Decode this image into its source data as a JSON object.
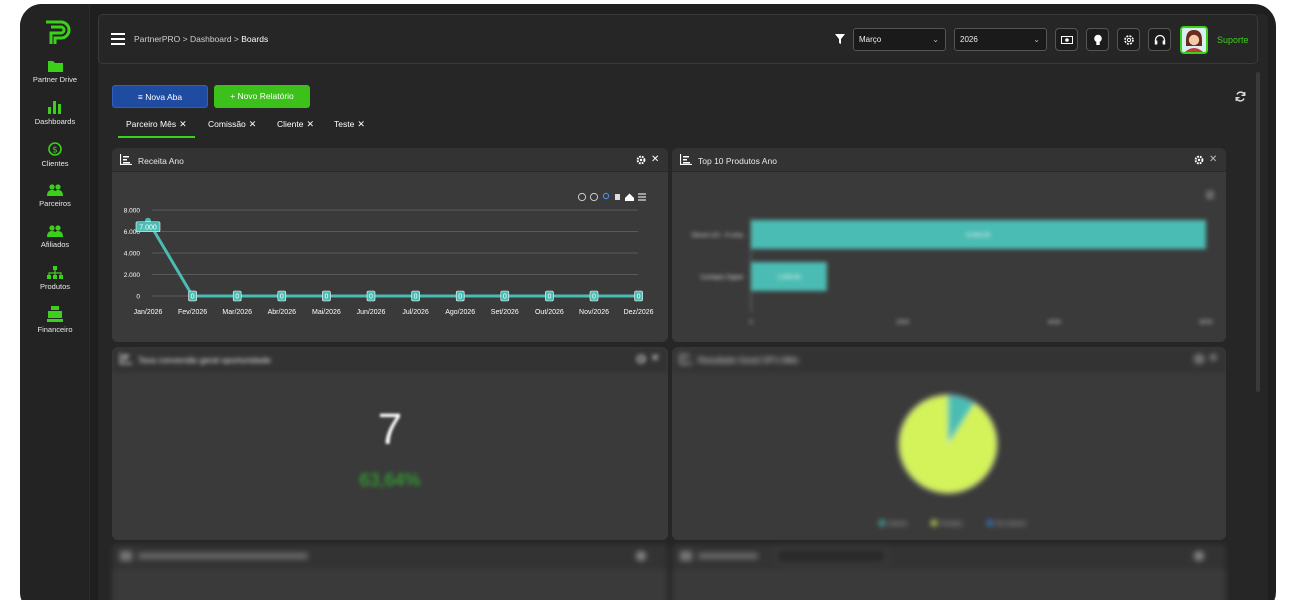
{
  "sidebar": {
    "items": [
      {
        "label": "Partner Drive",
        "icon": "folder-icon"
      },
      {
        "label": "Dashboards",
        "icon": "bar-chart-icon"
      },
      {
        "label": "Clientes",
        "icon": "dollar-circle-icon"
      },
      {
        "label": "Parceiros",
        "icon": "users-icon"
      },
      {
        "label": "Afiliados",
        "icon": "users-icon"
      },
      {
        "label": "Produtos",
        "icon": "hierarchy-icon"
      },
      {
        "label": "Financeiro",
        "icon": "cash-register-icon"
      }
    ]
  },
  "header": {
    "breadcrumb_prefix": "PartnerPRO > Dashboard > ",
    "breadcrumb_current": "Boards",
    "month_select": "Março",
    "year_select": "2026",
    "support_label": "Suporte"
  },
  "toolbar": {
    "new_tab_label": "Nova Aba",
    "new_report_label": "Novo Relatório"
  },
  "tabs": [
    {
      "label": "Parceiro Mês"
    },
    {
      "label": "Comissão"
    },
    {
      "label": "Cliente"
    },
    {
      "label": "Teste"
    }
  ],
  "panels": {
    "revenue": {
      "title": "Receita Ano"
    },
    "top_products": {
      "title": "Top 10 Produtos Ano"
    },
    "conversion": {
      "title": "Taxa conversão geral oportunidade",
      "value": "7",
      "percent": "63,64%"
    },
    "general_result": {
      "title": "Resultado Geral OP's Mês"
    }
  },
  "colors": {
    "accent_green": "#3bd11a",
    "teal": "#4bbcb3",
    "blue": "#1f4ba0",
    "lime": "#d4f25a"
  },
  "chart_data": [
    {
      "type": "line",
      "title": "Receita Ano",
      "categories": [
        "Jan/2026",
        "Fev/2026",
        "Mar/2026",
        "Abr/2026",
        "Mai/2026",
        "Jun/2026",
        "Jul/2026",
        "Ago/2026",
        "Set/2026",
        "Out/2026",
        "Nov/2026",
        "Dez/2026"
      ],
      "values": [
        7000,
        0,
        0,
        0,
        0,
        0,
        0,
        0,
        0,
        0,
        0,
        0
      ],
      "data_labels": [
        "7.000",
        "0",
        "0",
        "0",
        "0",
        "0",
        "0",
        "0",
        "0",
        "0",
        "0",
        "0"
      ],
      "y_ticks": [
        "8.000",
        "6.000",
        "4.000",
        "2.000",
        "0"
      ],
      "ylim": [
        0,
        8000
      ],
      "grid": true
    },
    {
      "type": "bar",
      "orientation": "horizontal",
      "title": "Top 10 Produtos Ano",
      "categories": [
        "Diesel s10 - À vista",
        "Cardapio Digital"
      ],
      "values": [
        6000,
        1000
      ],
      "data_labels": [
        "6.000,00",
        "1.000,00"
      ],
      "x_ticks": [
        "0",
        "2000",
        "4000",
        "6000"
      ],
      "xlim": [
        0,
        6000
      ]
    },
    {
      "type": "pie",
      "title": "Resultado Geral OP's Mês",
      "categories": [
        "Ganho",
        "Perdido",
        "Em Aberto"
      ],
      "values": [
        1,
        10,
        0
      ],
      "legend": "bottom"
    }
  ]
}
